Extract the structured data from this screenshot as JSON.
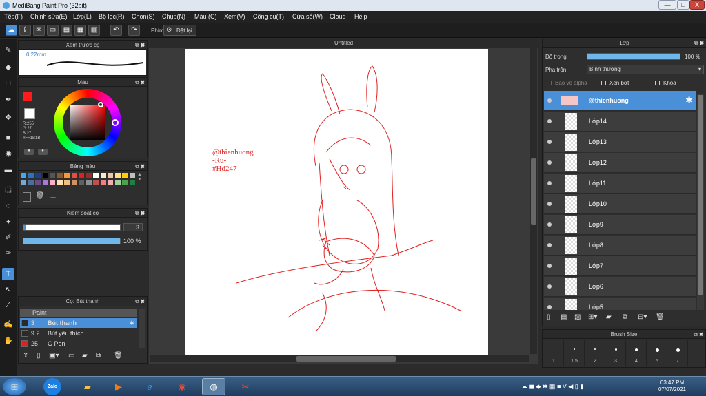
{
  "window": {
    "title": "MediBang Paint Pro (32bit)",
    "minimize": "—",
    "maximize": "□",
    "close": "X"
  },
  "menu": [
    "Tệp(F)",
    "Chỉnh sửa(E)",
    "Lớp(L)",
    "Bộ lọc(R)",
    "Chọn(S)",
    "Chụp(N)",
    "Màu (C)",
    "Xem(V)",
    "Công cụ(T)",
    "Cửa sổ(W)",
    "Cloud",
    "Help"
  ],
  "toolbar": {
    "phim_label": "Phím",
    "reset_label": "Đặt lại"
  },
  "brush_preview": {
    "title": "Xem trước cọ",
    "size": "0.22mm"
  },
  "color_panel": {
    "title": "Màu",
    "r": "R:255",
    "g": "G:27",
    "b": "B:27",
    "hex": "#FF1B1B"
  },
  "palette": {
    "title": "Bảng màu",
    "label": "---",
    "colors": [
      "#3fa9f5",
      "#2b72c4",
      "#1b3f8b",
      "#000000",
      "#555555",
      "#8a5a2b",
      "#f29a3b",
      "#e84c3d",
      "#e02020",
      "#9b2a2a",
      "#ffffff",
      "#f7e6d6",
      "#f2c6a0",
      "#ffe08a",
      "#ffd000",
      "#c0c0c0",
      "#7aa7d8",
      "#4b6f9a",
      "#6b4a8a",
      "#a67bd3",
      "#f7b0c8",
      "#ffe0b0",
      "#f0c080",
      "#d49060",
      "#606060",
      "#909090",
      "#c05050",
      "#f08080",
      "#f0b0b0",
      "#a0d0a0",
      "#50a050",
      "#208040"
    ]
  },
  "brush_control": {
    "title": "Kiểm soát cọ",
    "size_value": "3",
    "opacity_value": "100 %",
    "opacity": 1.0
  },
  "brush_list": {
    "title": "Cọ: Bút thanh",
    "group": "Paint",
    "items": [
      {
        "size": "3",
        "name": "Bút thanh",
        "color": "#2a2a2a",
        "selected": true
      },
      {
        "size": "9.2",
        "name": "Bút yêu thích",
        "color": "#2a2a2a",
        "selected": false
      },
      {
        "size": "25",
        "name": "G Pen",
        "color": "#e02020",
        "selected": false
      }
    ]
  },
  "canvas": {
    "doc_title": "Untitled",
    "watermark": [
      "@thienhuong",
      "-Ru-",
      "#Hd247"
    ],
    "ink": "#e02020"
  },
  "layers": {
    "title": "Lớp",
    "opacity_label": "Độ trong",
    "opacity_value": "100 %",
    "opacity": 1.0,
    "blend_label": "Pha trộn",
    "blend_value": "Bình thường",
    "protect_alpha": "Bảo vệ alpha",
    "clip": "Xén bớt",
    "lock": "Khóa",
    "items": [
      "@thienhuong",
      "Lớp14",
      "Lớp13",
      "Lớp12",
      "Lớp11",
      "Lớp10",
      "Lớp9",
      "Lớp8",
      "Lớp7",
      "Lớp6",
      "Lớp5"
    ]
  },
  "brush_size_panel": {
    "title": "Brush Size",
    "sizes": [
      "1",
      "1.5",
      "2",
      "3",
      "4",
      "5",
      "7"
    ]
  },
  "taskbar": {
    "zalo": "Zalo",
    "time": "03:47 PM",
    "date": "07/07/2021"
  }
}
